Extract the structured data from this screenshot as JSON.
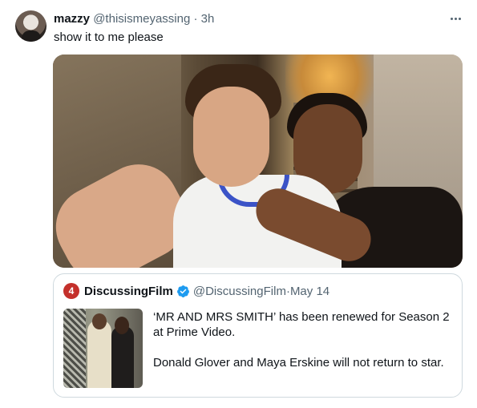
{
  "tweet": {
    "author_name": "mazzy",
    "author_handle": "@thisismeyassing",
    "separator": "·",
    "time": "3h",
    "text": "show it to me please",
    "more_icon": "more-icon",
    "avatar_icon": "avatar"
  },
  "quoted_tweet": {
    "logo_text": "4",
    "author_name": "DiscussingFilm",
    "verified_icon": "verified-badge-icon",
    "author_handle": "@DiscussingFilm",
    "separator": "·",
    "time": "May 14",
    "text_line1": "‘MR AND MRS SMITH’ has been renewed for Season 2 at Prime Video.",
    "text_line2": "Donald Glover and Maya Erskine will not return to star."
  },
  "colors": {
    "text_primary": "#0f1419",
    "text_secondary": "#536471",
    "border": "#cfd9de",
    "verified_blue": "#1d9bf0",
    "logo_red": "#c4302b"
  }
}
